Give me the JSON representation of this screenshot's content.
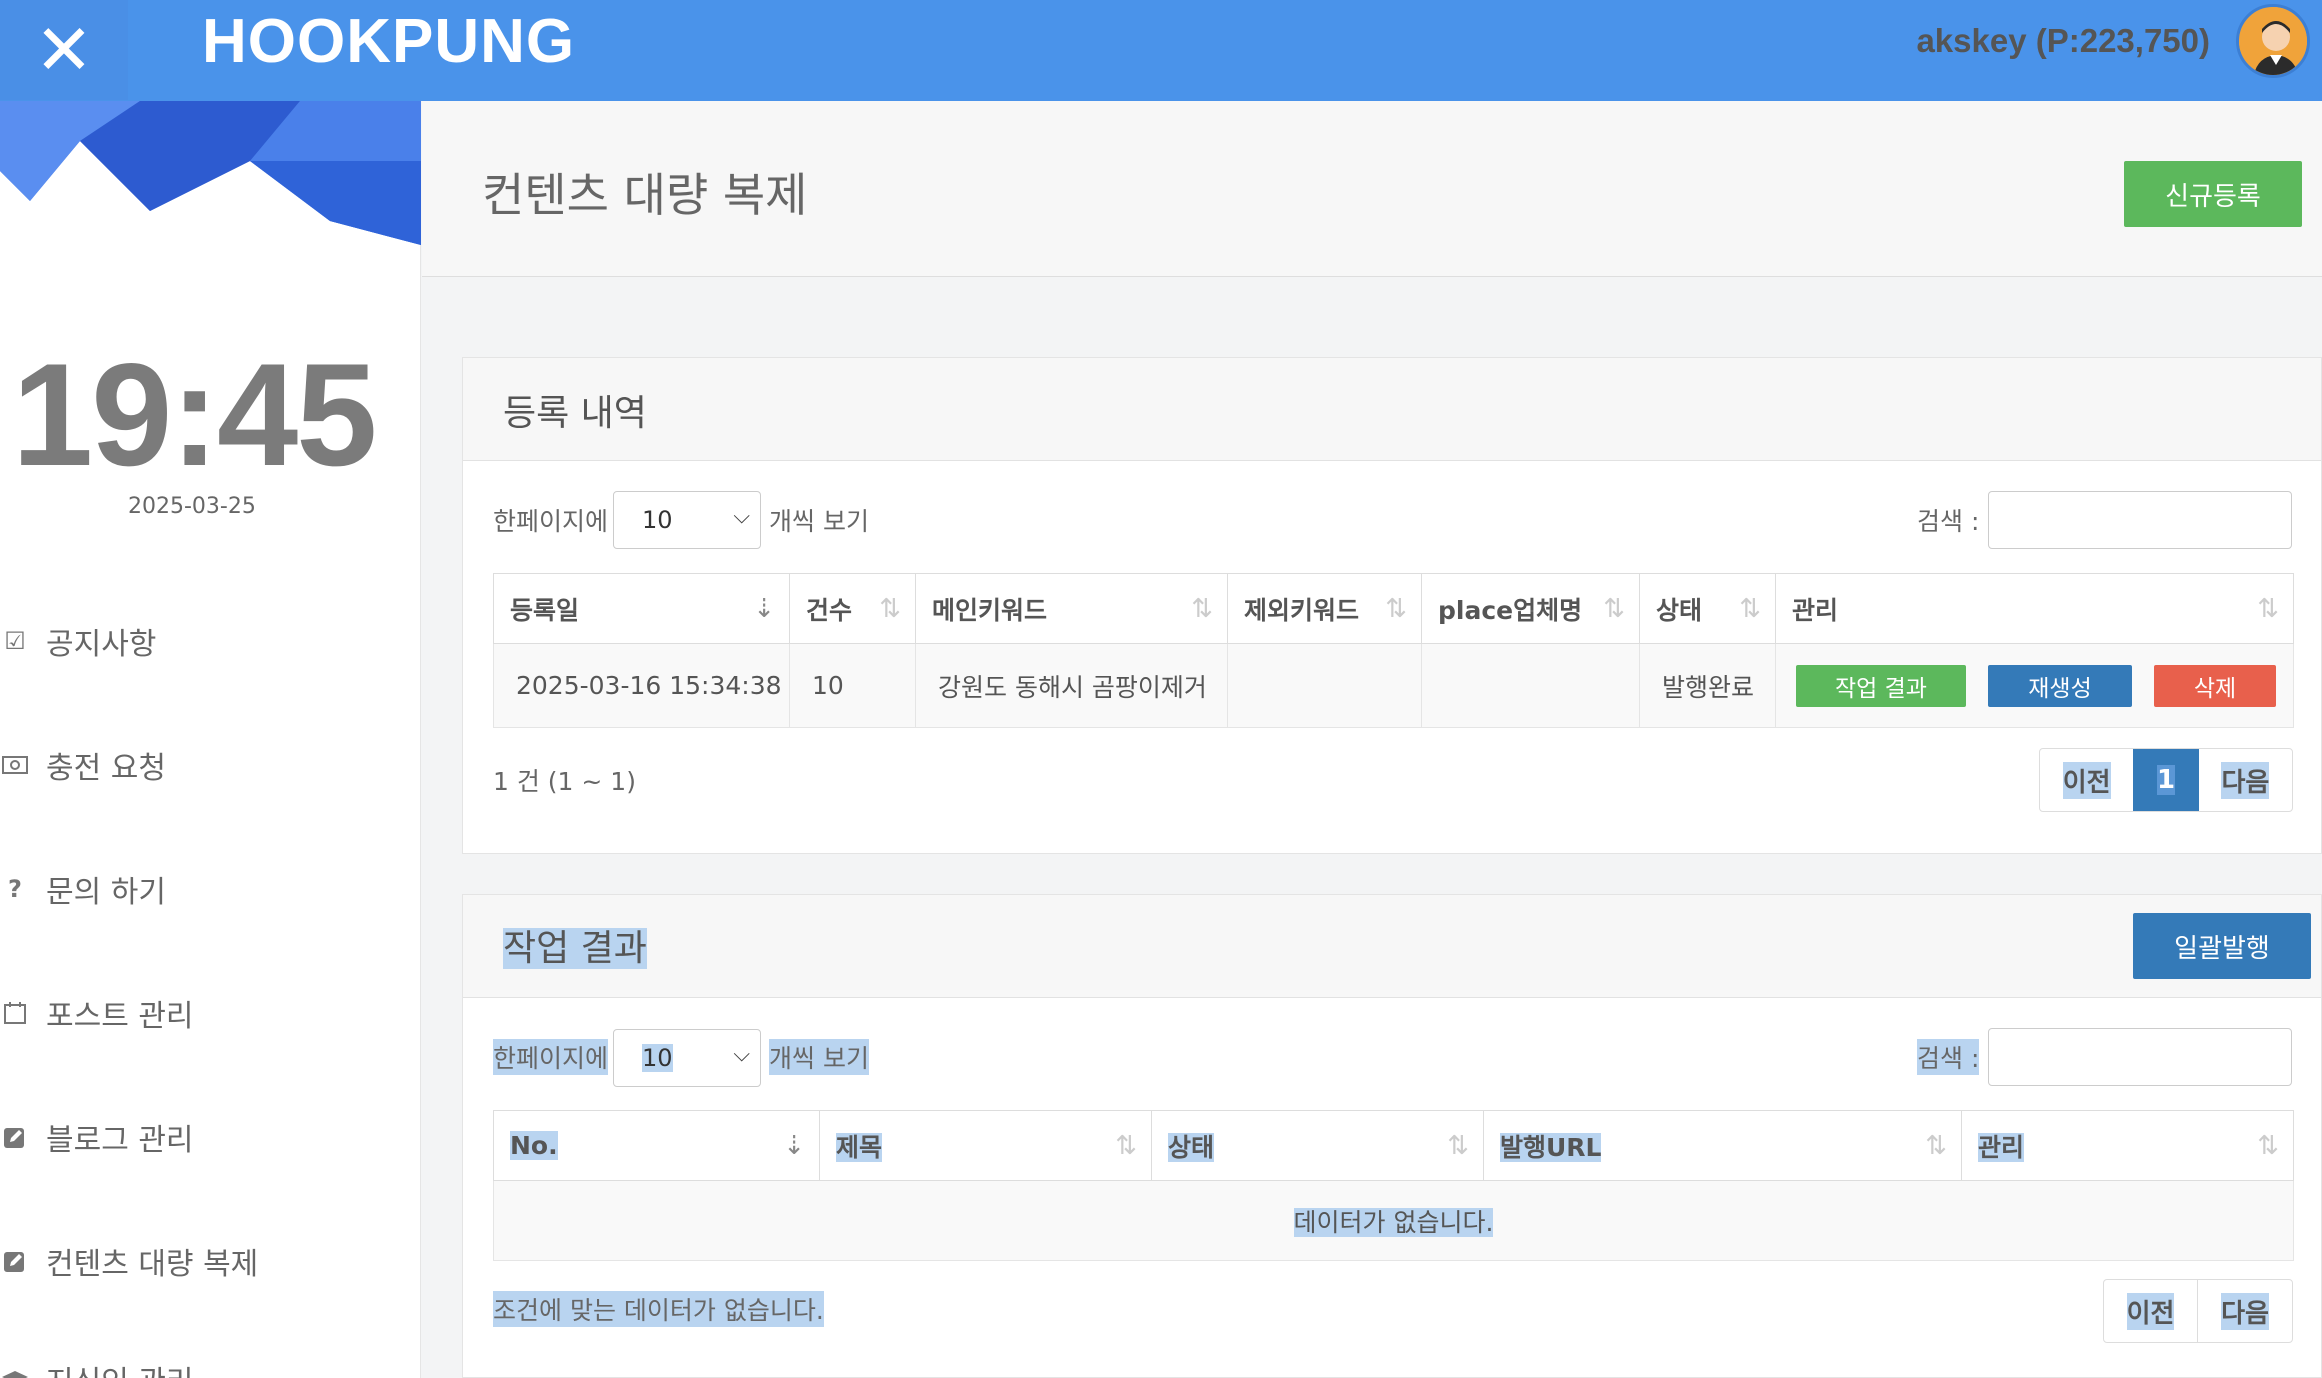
{
  "header": {
    "close_label": "✕",
    "brand": "HOOKPUNG",
    "user": "akskey (P:223,750)"
  },
  "sidebar": {
    "clock": "19:45",
    "date": "2025-03-25",
    "items": [
      {
        "label": "공지사항",
        "icon": "checkbox-icon"
      },
      {
        "label": "충전 요청",
        "icon": "money-icon"
      },
      {
        "label": "문의 하기",
        "icon": "question-icon"
      },
      {
        "label": "포스트 관리",
        "icon": "calendar-icon"
      },
      {
        "label": "블로그 관리",
        "icon": "edit-icon"
      },
      {
        "label": "컨텐츠 대량 복제",
        "icon": "edit-icon"
      },
      {
        "label": "지식인 관리",
        "icon": "graduation-cap-icon"
      }
    ]
  },
  "page": {
    "title": "컨텐츠 대량 복제",
    "new_button": "신규등록"
  },
  "registry": {
    "title": "등록 내역",
    "length_prefix": "한페이지에",
    "length_value": "10",
    "length_suffix": "개씩 보기",
    "search_label": "검색 :",
    "columns": [
      "등록일",
      "건수",
      "메인키워드",
      "제외키워드",
      "place업체명",
      "상태",
      "관리"
    ],
    "rows": [
      {
        "date": "2025-03-16 15:34:38",
        "count": "10",
        "main_keyword": "강원도 동해시 곰팡이제거",
        "exclude_keyword": "",
        "place": "",
        "status": "발행완료",
        "actions": {
          "result": "작업 결과",
          "regen": "재생성",
          "delete": "삭제"
        }
      }
    ],
    "info": "1 건 (1 ~ 1)",
    "pager": {
      "prev": "이전",
      "page": "1",
      "next": "다음"
    }
  },
  "results": {
    "title": "작업 결과",
    "publish_button": "일괄발행",
    "length_prefix": "한페이지에",
    "length_value": "10",
    "length_suffix": "개씩 보기",
    "search_label": "검색 :",
    "columns": [
      "No.",
      "제목",
      "상태",
      "발행URL",
      "관리"
    ],
    "empty": "데이터가 없습니다.",
    "info": "조건에 맞는 데이터가 없습니다.",
    "pager": {
      "prev": "이전",
      "next": "다음"
    }
  },
  "colors": {
    "topbar": "#4a93ea",
    "green": "#5cb85c",
    "blue": "#347ab8",
    "red": "#e8604c",
    "highlight": "#b9d4f0"
  }
}
